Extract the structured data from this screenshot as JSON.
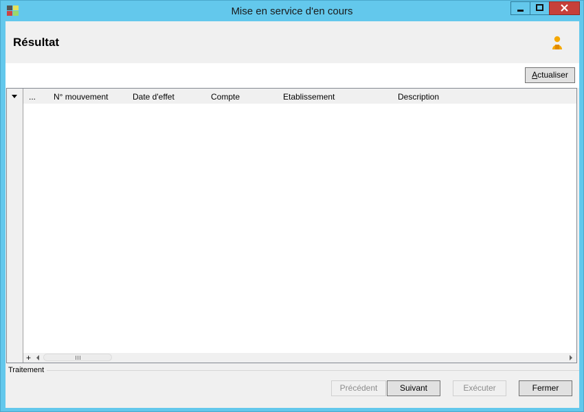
{
  "window": {
    "title": "Mise en service d'en cours",
    "controls": [
      "minimize-icon",
      "maximize-icon",
      "close-icon"
    ],
    "accent_color": "#63c8ec",
    "close_color": "#c7403a"
  },
  "header": {
    "title": "Résultat",
    "icon": "user-icon"
  },
  "toolbar": {
    "refresh_label_underlined": "A",
    "refresh_label_rest": "ctualiser"
  },
  "grid": {
    "selector_column": "...",
    "columns": [
      "N° mouvement",
      "Date d'effet",
      "Compte",
      "Etablissement",
      "Description"
    ],
    "rows": [],
    "add_label": "+"
  },
  "group": {
    "label": "Traitement"
  },
  "buttons": {
    "previous": "Précédent",
    "next": "Suivant",
    "execute": "Exécuter",
    "close": "Fermer"
  }
}
